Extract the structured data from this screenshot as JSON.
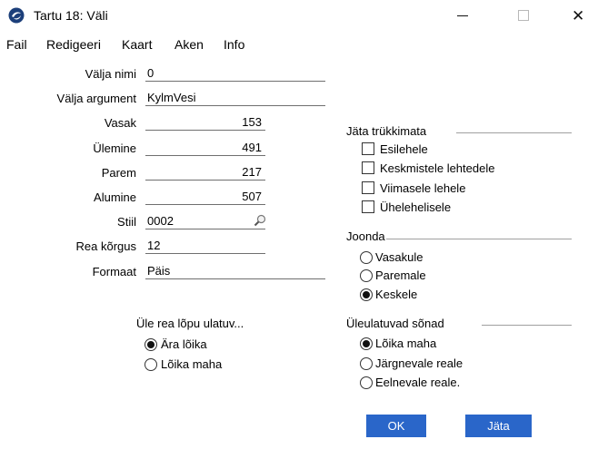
{
  "window": {
    "title": "Tartu 18: Väli",
    "close_glyph": "✕",
    "icon": "app-logo-icon"
  },
  "menu": [
    "Fail",
    "Redigeeri",
    "Kaart",
    "Aken",
    "Info"
  ],
  "fields": {
    "valja_nimi": {
      "label": "Välja nimi",
      "value": "0"
    },
    "valja_argument": {
      "label": "Välja argument",
      "value": "KylmVesi"
    },
    "vasak": {
      "label": "Vasak",
      "value": "153"
    },
    "ulemine": {
      "label": "Ülemine",
      "value": "491"
    },
    "parem": {
      "label": "Parem",
      "value": "217"
    },
    "alumine": {
      "label": "Alumine",
      "value": "507"
    },
    "stiil": {
      "label": "Stiil",
      "value": "0002"
    },
    "rea_korgus": {
      "label": "Rea kõrgus",
      "value": "12"
    },
    "formaat": {
      "label": "Formaat",
      "value": "Päis"
    }
  },
  "jata_trukkimata": {
    "title": "Jäta trükkimata",
    "options": [
      {
        "label": "Esilehele",
        "checked": false
      },
      {
        "label": "Keskmistele lehtedele",
        "checked": false
      },
      {
        "label": "Viimasele lehele",
        "checked": false
      },
      {
        "label": "Ühelehelisele",
        "checked": false
      }
    ]
  },
  "joonda": {
    "title": "Joonda",
    "options": [
      {
        "label": "Vasakule",
        "selected": false
      },
      {
        "label": "Paremale",
        "selected": false
      },
      {
        "label": "Keskele",
        "selected": true
      }
    ]
  },
  "ule_rea": {
    "title": "Üle rea lõpu ulatuv...",
    "options": [
      {
        "label": "Ära lõika",
        "selected": true
      },
      {
        "label": "Lõika maha",
        "selected": false
      }
    ]
  },
  "uleulatuvad": {
    "title": "Üleulatuvad sõnad",
    "options": [
      {
        "label": "Lõika maha",
        "selected": true
      },
      {
        "label": "Järgnevale reale",
        "selected": false
      },
      {
        "label": "Eelnevale reale.",
        "selected": false
      }
    ]
  },
  "buttons": {
    "ok": "OK",
    "cancel": "Jäta"
  },
  "colors": {
    "button_bg": "#2a66c9",
    "button_text": "#ffffff"
  }
}
